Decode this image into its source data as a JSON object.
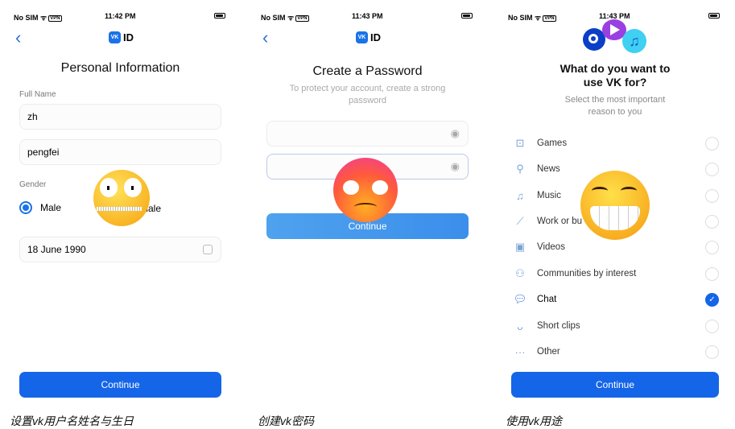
{
  "screens": [
    {
      "status": {
        "carrier": "No SIM",
        "vpn": "VPN",
        "time": "11:42 PM"
      },
      "logo": {
        "badge": "VK",
        "text": "ID"
      },
      "title": "Personal Information",
      "full_name_label": "Full Name",
      "first_name": "zh",
      "last_name": "pengfei",
      "gender_label": "Gender",
      "gender_options": [
        "Male",
        "Female"
      ],
      "gender_selected": "Male",
      "birthdate": "18 June 1990",
      "continue": "Continue",
      "caption": "设置vk用户名姓名与生日"
    },
    {
      "status": {
        "carrier": "No SIM",
        "vpn": "VPN",
        "time": "11:43 PM"
      },
      "logo": {
        "badge": "VK",
        "text": "ID"
      },
      "title": "Create a Password",
      "subtitle": "To protect your account, create a strong password",
      "password": "",
      "password_confirm": "",
      "continue": "Continue",
      "caption": "创建vk密码"
    },
    {
      "status": {
        "carrier": "No SIM",
        "vpn": "VPN",
        "time": "11:43 PM"
      },
      "title": "What do you want to use VK for?",
      "subtitle": "Select the most important reason to you",
      "options": [
        {
          "label": "Games",
          "icon": "gamepad-icon",
          "checked": false
        },
        {
          "label": "News",
          "icon": "search-icon",
          "checked": false
        },
        {
          "label": "Music",
          "icon": "music-note-icon",
          "checked": false
        },
        {
          "label": "Work or bu",
          "icon": "chart-line-icon",
          "checked": false
        },
        {
          "label": "Videos",
          "icon": "play-icon",
          "checked": false
        },
        {
          "label": "Communities by interest",
          "icon": "people-icon",
          "checked": false
        },
        {
          "label": "Chat",
          "icon": "chat-icon",
          "checked": true
        },
        {
          "label": "Short clips",
          "icon": "clips-icon",
          "checked": false
        },
        {
          "label": "Other",
          "icon": "dots-icon",
          "checked": false
        }
      ],
      "continue": "Continue",
      "caption": "使用vk用途"
    }
  ],
  "colors": {
    "accent": "#1565e8",
    "light_button": "#4fa2ee",
    "icon": "#7aa3d6"
  }
}
